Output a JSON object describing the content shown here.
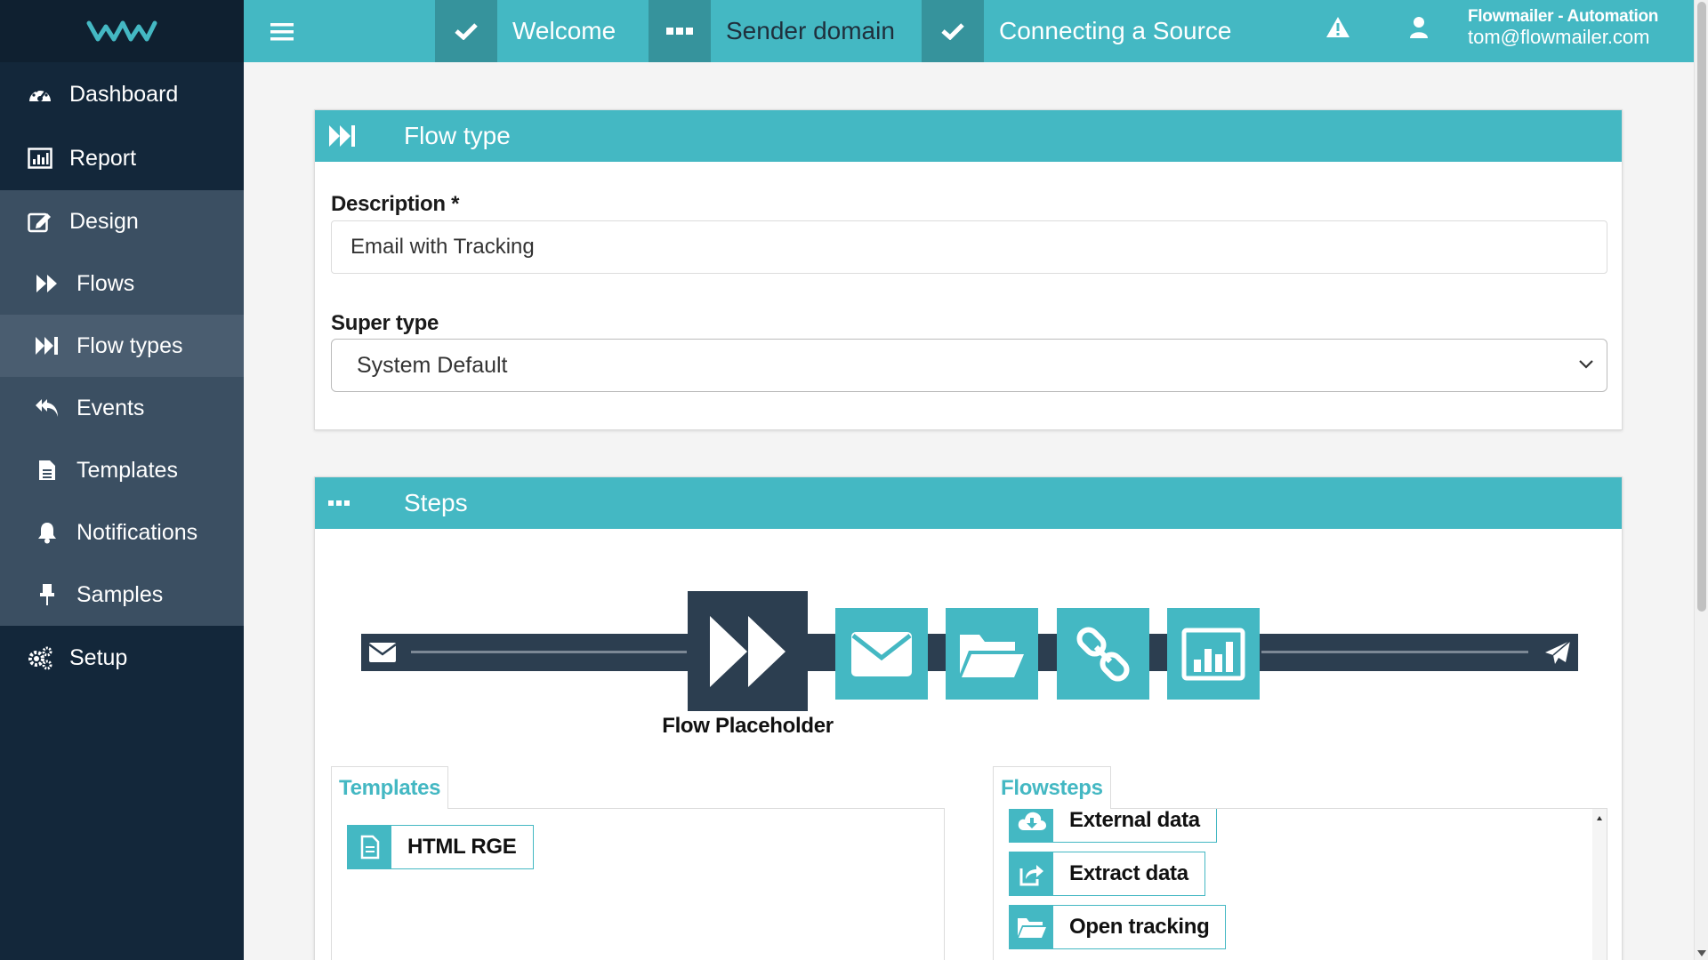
{
  "sidebar": {
    "logo_icon": "flowmailer-logo",
    "items": [
      {
        "label": "Dashboard",
        "icon": "dashboard-icon"
      },
      {
        "label": "Report",
        "icon": "report-icon"
      },
      {
        "label": "Design",
        "icon": "design-icon"
      }
    ],
    "sub_items": [
      {
        "label": "Flows",
        "icon": "fast-forward-icon"
      },
      {
        "label": "Flow types",
        "icon": "skip-forward-icon"
      },
      {
        "label": "Events",
        "icon": "reply-all-icon"
      },
      {
        "label": "Templates",
        "icon": "file-icon"
      },
      {
        "label": "Notifications",
        "icon": "bell-icon"
      },
      {
        "label": "Samples",
        "icon": "pin-icon"
      }
    ],
    "setup": {
      "label": "Setup",
      "icon": "gears-icon"
    }
  },
  "topbar": {
    "steps": [
      {
        "label": "Welcome",
        "icon": "check-icon"
      },
      {
        "label": "Sender domain",
        "icon": "ellipsis-icon"
      },
      {
        "label": "Connecting a Source",
        "icon": "check-icon"
      }
    ],
    "user": {
      "organization": "Flowmailer - Automation",
      "email": "tom@flowmailer.com"
    }
  },
  "flow_type_panel": {
    "title": "Flow type",
    "description_label": "Description *",
    "description_value": "Email with Tracking",
    "super_type_label": "Super type",
    "super_type_value": "System Default"
  },
  "steps_panel": {
    "title": "Steps",
    "placeholder_label": "Flow Placeholder",
    "flow_steps": [
      {
        "icon": "envelope-icon"
      },
      {
        "icon": "folder-open-icon"
      },
      {
        "icon": "link-icon"
      },
      {
        "icon": "bar-chart-icon"
      }
    ],
    "templates_tab": "Templates",
    "templates": [
      "HTML RGE"
    ],
    "flowsteps_tab": "Flowsteps",
    "flowsteps": [
      {
        "label": "External data",
        "icon": "cloud-download-icon"
      },
      {
        "label": "Extract data",
        "icon": "share-icon"
      },
      {
        "label": "Open tracking",
        "icon": "folder-open-icon"
      }
    ]
  },
  "colors": {
    "accent": "#44b8c3",
    "accent_dark": "#36939c",
    "sidebar": "#13273a",
    "track": "#2c3e50"
  }
}
